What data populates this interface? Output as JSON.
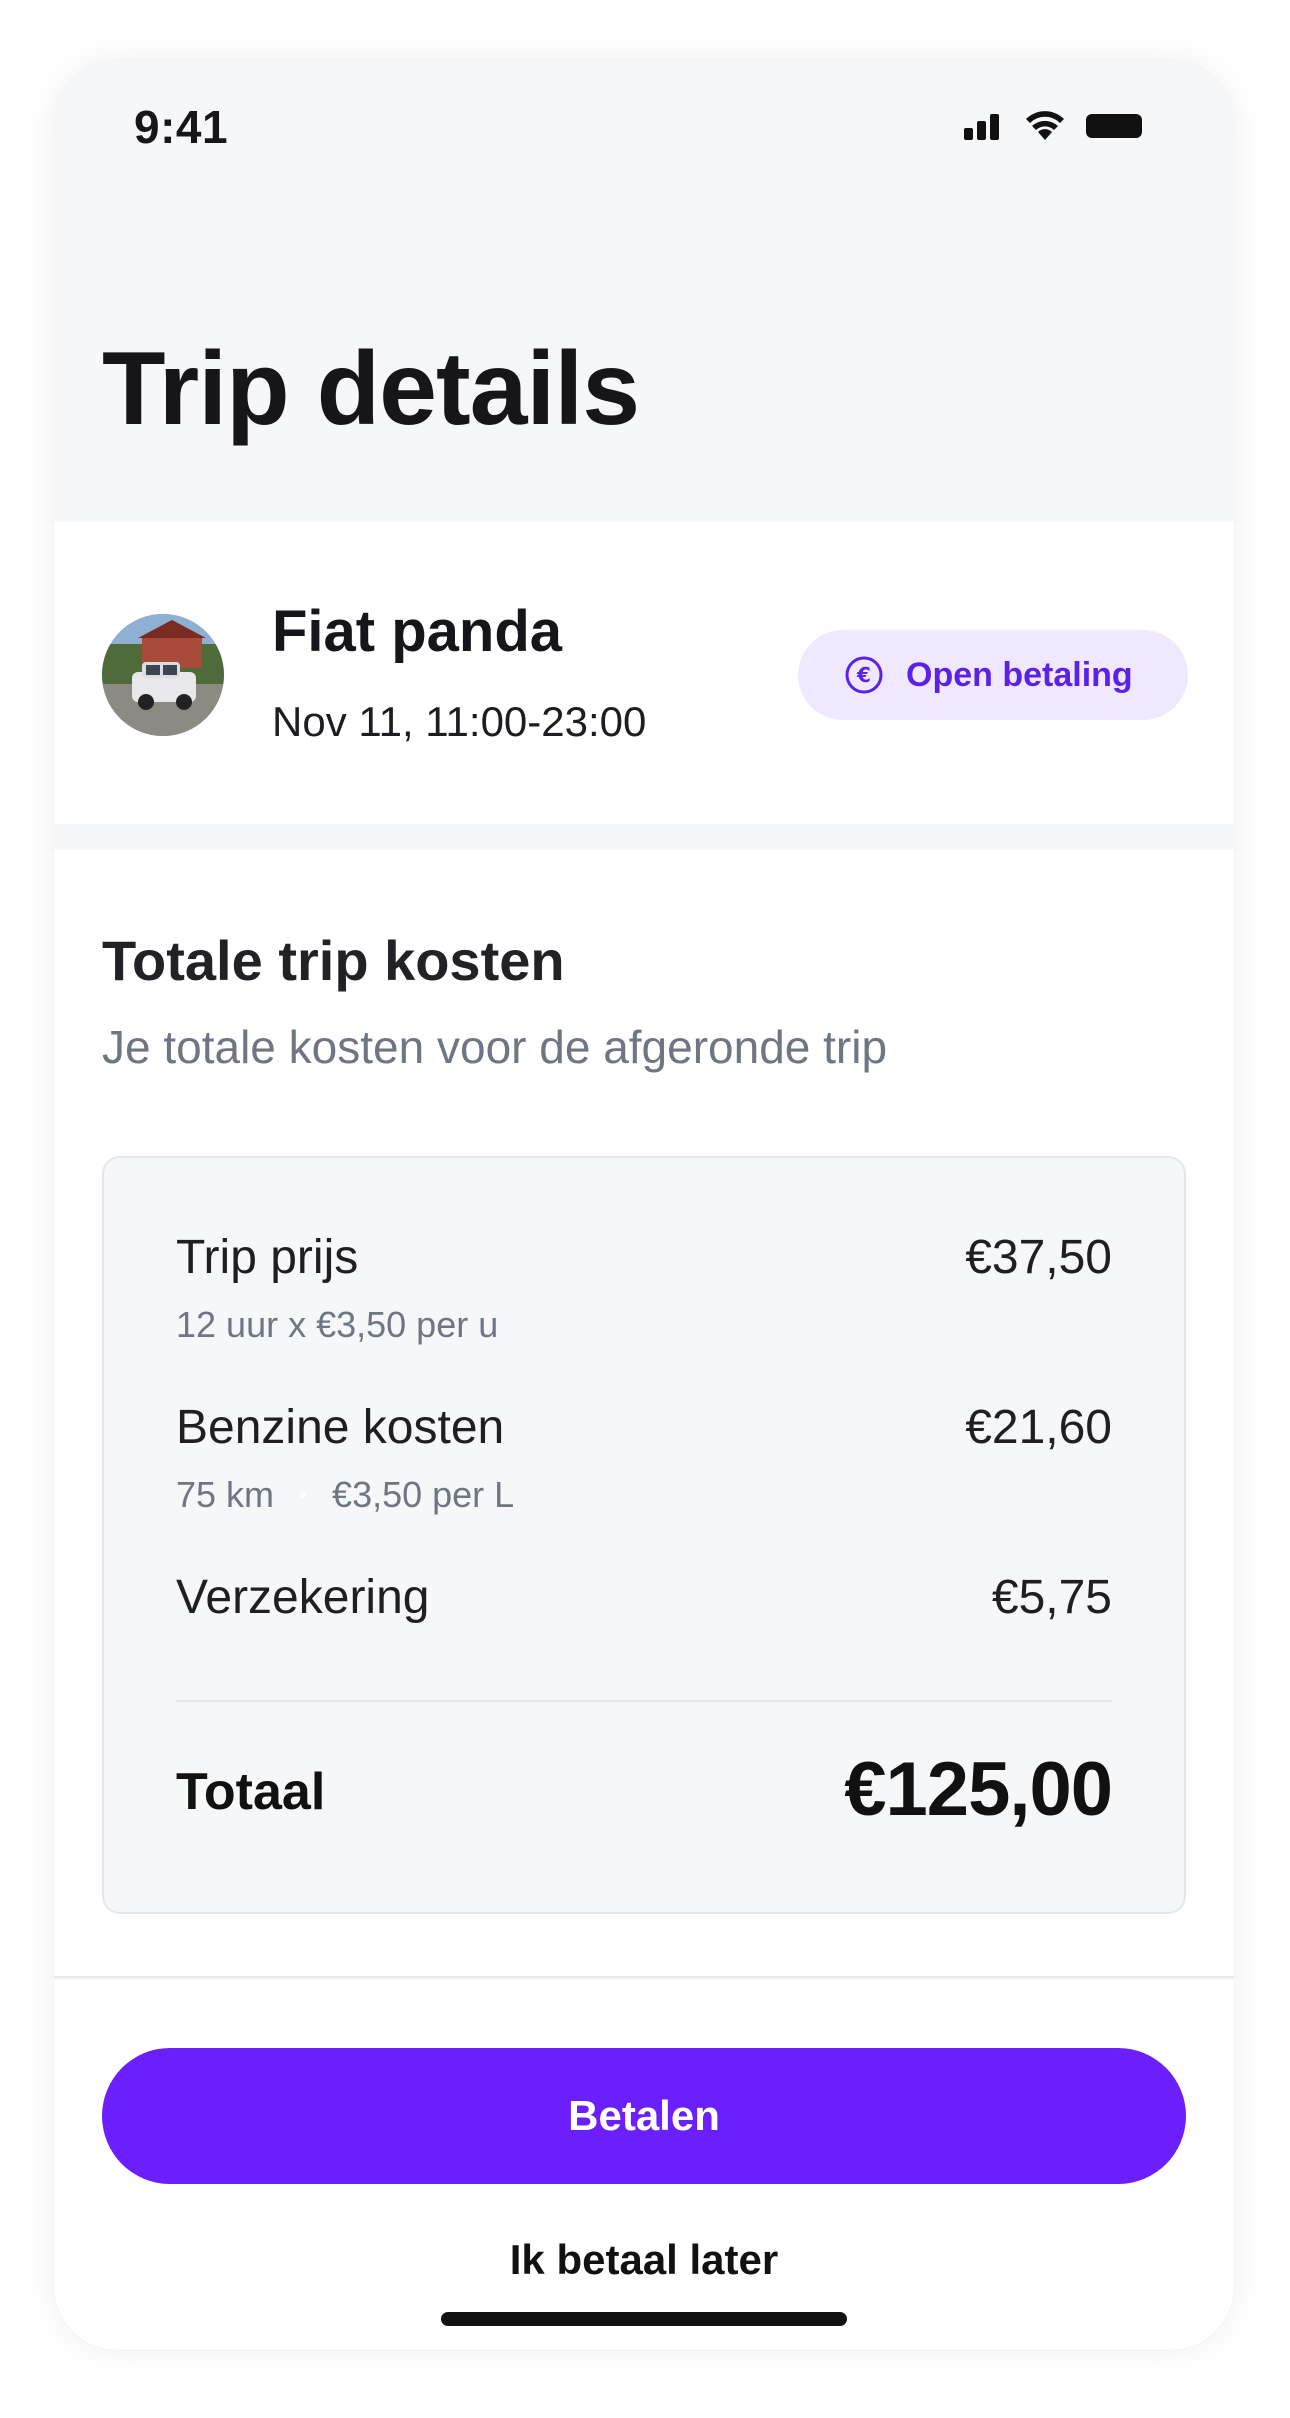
{
  "status_bar": {
    "time": "9:41"
  },
  "header": {
    "title": "Trip details"
  },
  "trip": {
    "name": "Fiat panda",
    "date": "Nov 11, 11:00-23:00",
    "badge": {
      "label": "Open betaling",
      "icon": "euro-icon"
    }
  },
  "costs": {
    "title": "Totale trip kosten",
    "subtitle": "Je totale kosten voor de afgeronde trip",
    "items": [
      {
        "label": "Trip prijs",
        "amount": "€37,50",
        "detail": "12 uur x €3,50 per u"
      },
      {
        "label": "Benzine kosten",
        "amount": "€21,60",
        "detail_parts": [
          "75 km",
          "€3,50 per L"
        ]
      },
      {
        "label": "Verzekering",
        "amount": "€5,75"
      }
    ],
    "total_label": "Totaal",
    "total_amount": "€125,00"
  },
  "actions": {
    "pay_label": "Betalen",
    "later_label": "Ik betaal later"
  },
  "colors": {
    "accent": "#6a1ffc",
    "badge_bg": "#efe8ff",
    "badge_text": "#5b21e6",
    "muted_text": "#6e7684"
  }
}
